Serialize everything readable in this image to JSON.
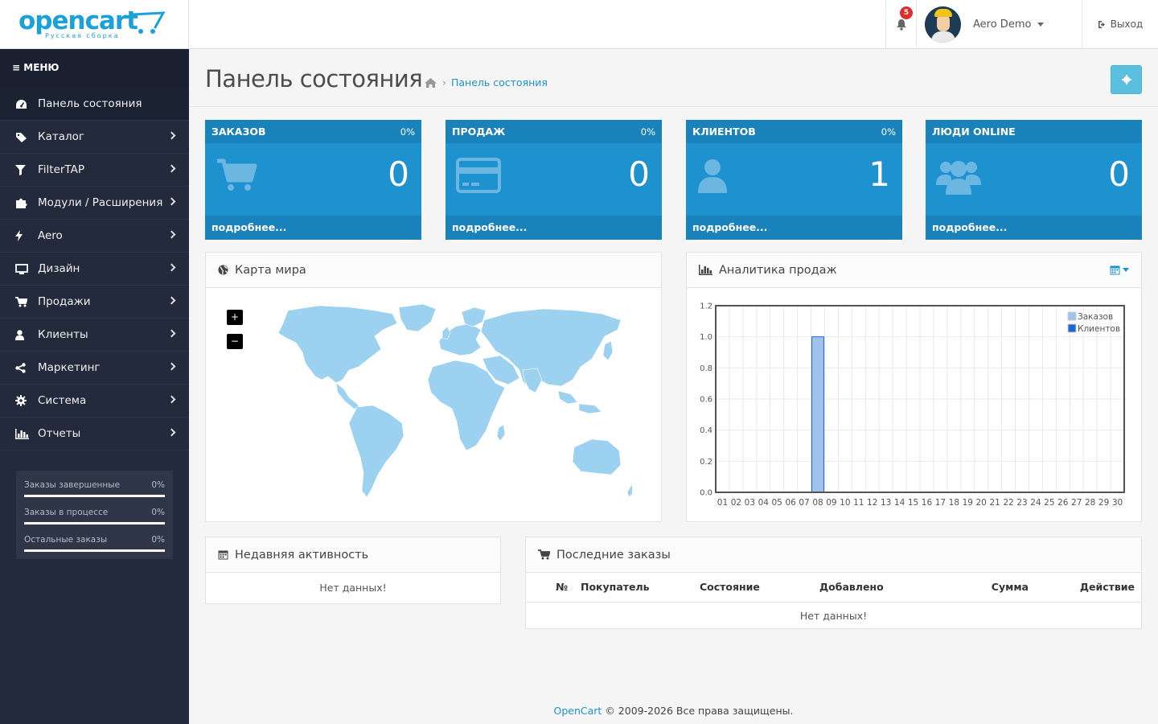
{
  "header": {
    "logo_text": "opencart",
    "logo_sub": "Русская сборка",
    "notification_count": "5",
    "user_name": "Aero Demo",
    "logout_label": "Выход",
    "icons": [
      "bell-icon",
      "avatar",
      "caret-down-icon",
      "sign-out-icon"
    ]
  },
  "sidebar": {
    "menu_label": "МЕНЮ",
    "items": [
      {
        "label": "Панель состояния",
        "icon": "dashboard-icon",
        "has_children": false
      },
      {
        "label": "Каталог",
        "icon": "tags-icon",
        "has_children": true
      },
      {
        "label": "FilterTAP",
        "icon": "filter-icon",
        "has_children": true
      },
      {
        "label": "Модули / Расширения",
        "icon": "puzzle-icon",
        "has_children": true
      },
      {
        "label": "Aero",
        "icon": "bolt-icon",
        "has_children": true
      },
      {
        "label": "Дизайн",
        "icon": "desktop-icon",
        "has_children": true
      },
      {
        "label": "Продажи",
        "icon": "cart-icon",
        "has_children": true
      },
      {
        "label": "Клиенты",
        "icon": "user-icon",
        "has_children": true
      },
      {
        "label": "Маркетинг",
        "icon": "share-icon",
        "has_children": true
      },
      {
        "label": "Система",
        "icon": "cog-icon",
        "has_children": true
      },
      {
        "label": "Отчеты",
        "icon": "bar-chart-icon",
        "has_children": true
      }
    ],
    "stats": [
      {
        "label": "Заказы завершенные",
        "pct": "0%",
        "progress": 0
      },
      {
        "label": "Заказы в процессе",
        "pct": "0%",
        "progress": 0
      },
      {
        "label": "Остальные заказы",
        "pct": "0%",
        "progress": 0
      }
    ]
  },
  "page": {
    "title": "Панель состояния",
    "breadcrumb": "Панель состояния",
    "settings_icon": "cog-icon"
  },
  "tiles": [
    {
      "title": "ЗАКАЗОВ",
      "pct": "0%",
      "value": "0",
      "icon": "cart-icon",
      "more": "подробнее..."
    },
    {
      "title": "ПРОДАЖ",
      "pct": "0%",
      "value": "0",
      "icon": "credit-card-icon",
      "more": "подробнее..."
    },
    {
      "title": "КЛИЕНТОВ",
      "pct": "0%",
      "value": "1",
      "icon": "user-icon",
      "more": "подробнее..."
    },
    {
      "title": "ЛЮДИ ONLINE",
      "pct": "",
      "value": "0",
      "icon": "users-icon",
      "more": "подробнее..."
    }
  ],
  "map_panel": {
    "title": "Карта мира",
    "zoom_in": "+",
    "zoom_out": "−",
    "land_color": "#9cd1ef"
  },
  "analytics_panel": {
    "title": "Аналитика продаж",
    "calendar_icon": "calendar-icon"
  },
  "chart_data": {
    "type": "bar",
    "categories": [
      "01",
      "02",
      "03",
      "04",
      "05",
      "06",
      "07",
      "08",
      "09",
      "10",
      "11",
      "12",
      "13",
      "14",
      "15",
      "16",
      "17",
      "18",
      "19",
      "20",
      "21",
      "22",
      "23",
      "24",
      "25",
      "26",
      "27",
      "28",
      "29",
      "30"
    ],
    "series": [
      {
        "name": "Заказов",
        "color": "#9fc3ec",
        "values": [
          0,
          0,
          0,
          0,
          0,
          0,
          0,
          0,
          0,
          0,
          0,
          0,
          0,
          0,
          0,
          0,
          0,
          0,
          0,
          0,
          0,
          0,
          0,
          0,
          0,
          0,
          0,
          0,
          0,
          0
        ]
      },
      {
        "name": "Клиентов",
        "color": "#1c69d3",
        "values": [
          0,
          0,
          0,
          0,
          0,
          0,
          0,
          1,
          0,
          0,
          0,
          0,
          0,
          0,
          0,
          0,
          0,
          0,
          0,
          0,
          0,
          0,
          0,
          0,
          0,
          0,
          0,
          0,
          0,
          0
        ]
      }
    ],
    "y_ticks": [
      "0.0",
      "0.2",
      "0.4",
      "0.6",
      "0.8",
      "1.0",
      "1.2"
    ],
    "ylim": [
      0,
      1.2
    ],
    "grid": true,
    "legend_position": "top-right"
  },
  "activity_panel": {
    "title": "Недавняя активность",
    "empty": "Нет данных!"
  },
  "orders_panel": {
    "title": "Последние заказы",
    "columns": [
      "№",
      "Покупатель",
      "Состояние",
      "Добавлено",
      "Сумма",
      "Действие"
    ],
    "empty": "Нет данных!"
  },
  "footer": {
    "brand": "OpenCart",
    "text": " © 2009-2026 Все права защищены."
  }
}
